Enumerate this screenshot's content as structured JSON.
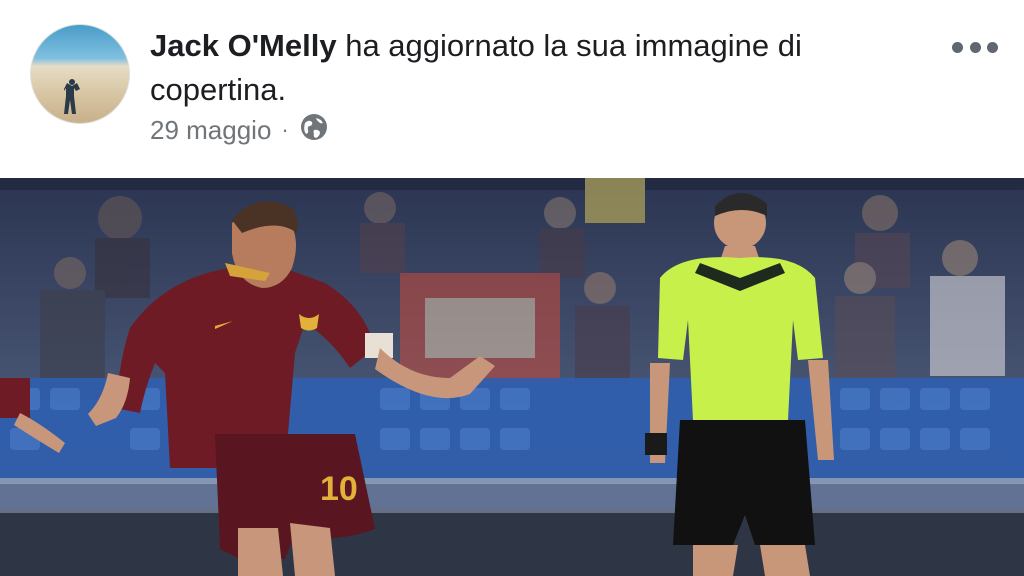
{
  "post": {
    "author": "Jack O'Melly",
    "action": " ha aggiornato la sua immagine di copertina.",
    "date": "29 maggio",
    "separator": "·",
    "privacy_icon": "globe-icon",
    "menu_icon": "more-options-icon"
  },
  "photo": {
    "jersey_number": "10",
    "colors": {
      "kit": "#6e1b26",
      "referee": "#c8f04a",
      "seats": "#2f5fb0"
    }
  }
}
